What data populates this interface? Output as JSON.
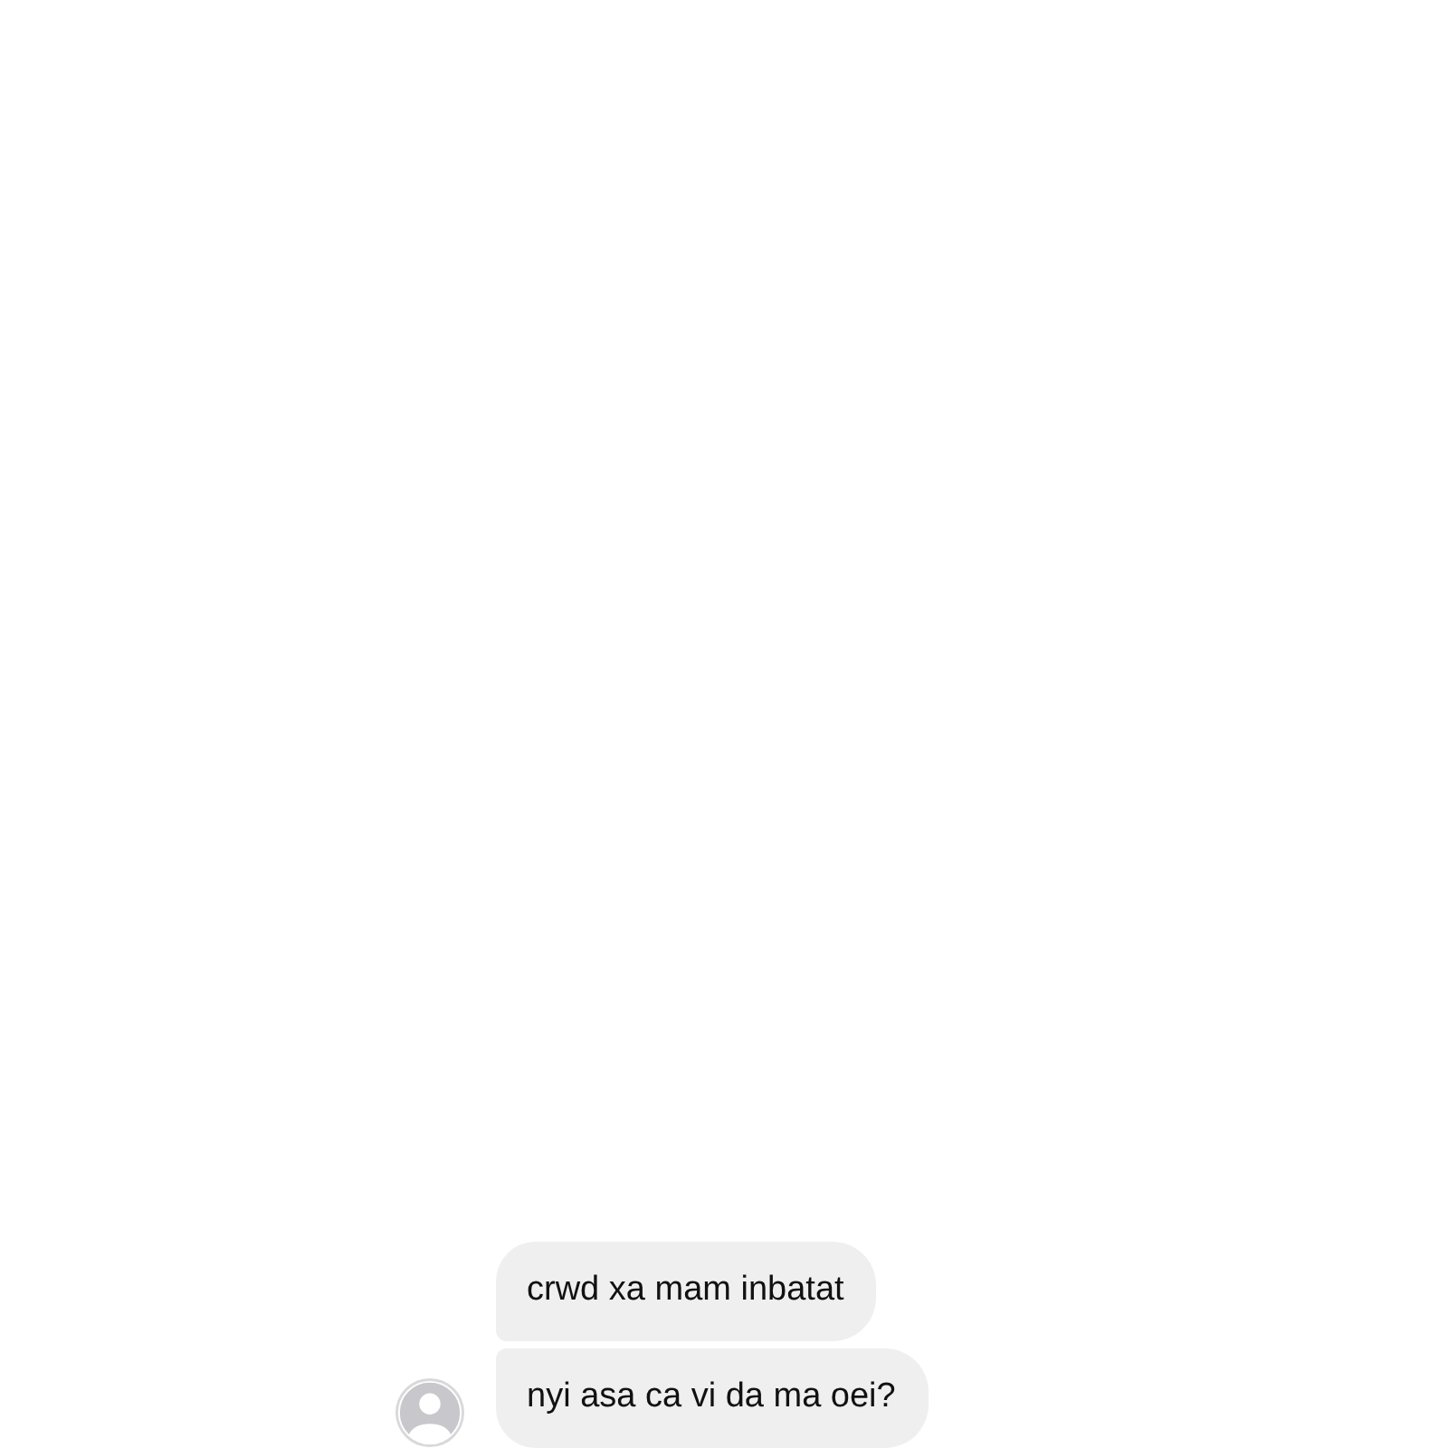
{
  "messages": [
    {
      "text": "crwd xa mam inbatat"
    },
    {
      "text": "nyi asa ca vi da ma oei?"
    }
  ]
}
